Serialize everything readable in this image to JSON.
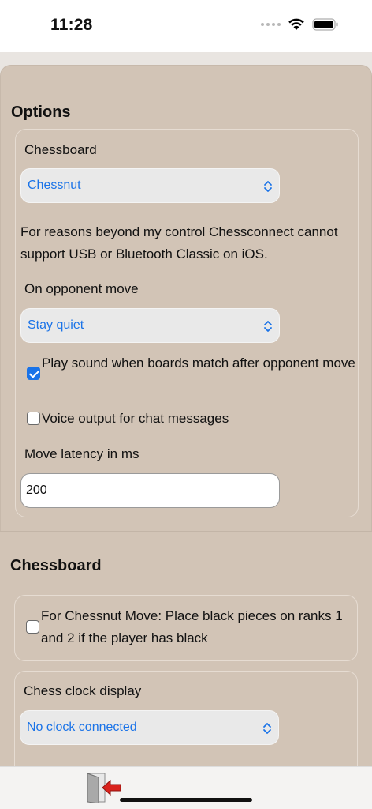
{
  "status": {
    "time": "11:28"
  },
  "options": {
    "title": "Options",
    "chessboard_label": "Chessboard",
    "chessboard_value": "Chessnut",
    "notice": "For reasons beyond my control Chessconnect cannot support USB or Bluetooth Classic on iOS.",
    "opponent_label": "On opponent move",
    "opponent_value": "Stay quiet",
    "play_sound_label": "Play sound when boards match after opponent move",
    "play_sound_checked": true,
    "voice_output_label": "Voice output for chat messages",
    "voice_output_checked": false,
    "latency_label": "Move latency in ms",
    "latency_value": "200"
  },
  "chessboard": {
    "title": "Chessboard",
    "black_pieces_label": "For Chessnut Move: Place black pieces on ranks 1 and 2 if the player has black",
    "black_pieces_checked": false,
    "clock_label": "Chess clock display",
    "clock_value": "No clock connected"
  },
  "toolbar": {
    "exit_icon": "exit-door-icon"
  },
  "colors": {
    "accent": "#1a73e8",
    "panel": "#d2c4b6",
    "background": "#e9e5e1"
  }
}
